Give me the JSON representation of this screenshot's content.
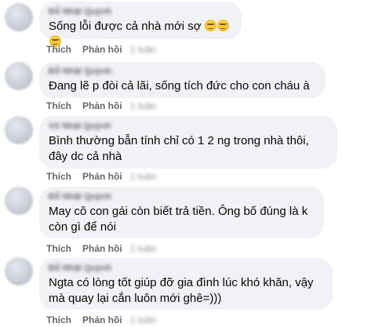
{
  "comments": [
    {
      "author": "Đỗ Nhật Quỳnh",
      "text": "Sống lỗi được cả nhà mới sợ",
      "emoji": [
        "upside-down-face-icon",
        "upside-down-face-icon",
        "upside-down-face-icon"
      ],
      "like_label": "Thích",
      "reply_label": "Phản hồi",
      "time": "1 tuần"
    },
    {
      "author": "Đỗ Nhật Quỳnh",
      "text": "Đang lẽ p đòi cả lãi, sống tích đức cho con cháu à",
      "like_label": "Thích",
      "reply_label": "Phản hồi",
      "time": "1 tuần"
    },
    {
      "author": "Vũ Nhật Quỳnh",
      "text": "Bình thường bẫn tính chỉ có 1 2 ng trong nhà thôi, đây dc cả nhà",
      "like_label": "Thích",
      "reply_label": "Phản hồi",
      "time": "1 tuần"
    },
    {
      "author": "Đỗ Nhật Quỳnh",
      "text": "May cô con gái còn biết trả tiền. Ông bố đúng là k còn gì để nói",
      "like_label": "Thích",
      "reply_label": "Phản hồi",
      "time": "1 tuần"
    },
    {
      "author": "Đỗ Nhật Quỳnh",
      "text": "Ngta có lòng tốt giúp đỡ gia đình lúc khó khăn, vậy mà quay lại cắn luôn mới ghê=)))",
      "like_label": "Thích",
      "reply_label": "Phản hồi",
      "time": "1 tuần"
    }
  ]
}
